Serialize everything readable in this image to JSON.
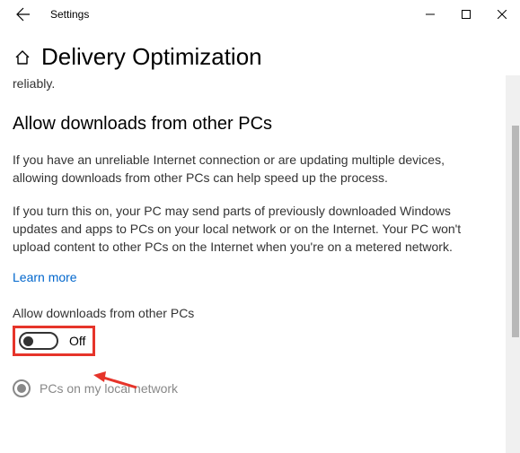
{
  "titlebar": {
    "title": "Settings"
  },
  "page": {
    "title": "Delivery Optimization"
  },
  "content": {
    "prev_line": "reliably.",
    "section_title": "Allow downloads from other PCs",
    "para1": "If you have an unreliable Internet connection or are updating multiple devices, allowing downloads from other PCs can help speed up the process.",
    "para2": "If you turn this on, your PC may send parts of previously downloaded Windows updates and apps to PCs on your local network or on the Internet. Your PC won't upload content to other PCs on the Internet when you're on a metered network.",
    "learn_more": "Learn more",
    "toggle_label": "Allow downloads from other PCs",
    "toggle_state": "Off",
    "radio1_label": "PCs on my local network"
  }
}
